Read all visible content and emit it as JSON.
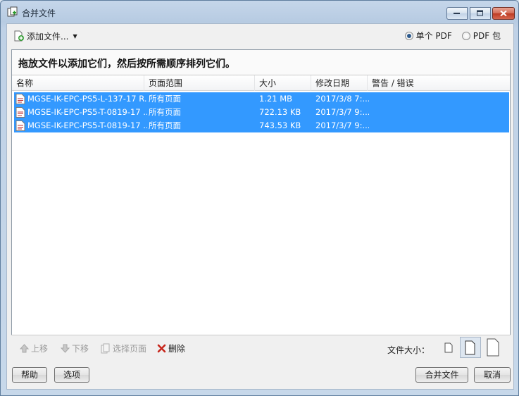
{
  "window": {
    "title": "合并文件",
    "controls": {
      "minimize": "minimize-icon",
      "maximize": "maximize-icon",
      "close": "close-icon"
    }
  },
  "toolbar_top": {
    "add_file_label": "添加文件...",
    "output_options": [
      {
        "label": "单个 PDF",
        "selected": true
      },
      {
        "label": "PDF 包",
        "selected": false
      }
    ]
  },
  "instruction": "拖放文件以添加它们，然后按所需顺序排列它们。",
  "table": {
    "columns": [
      "名称",
      "页面范围",
      "大小",
      "修改日期",
      "警告 / 错误"
    ],
    "rows": [
      {
        "name": "MGSE-IK-EPC-PS5-L-137-17 R...",
        "range": "所有页面",
        "size": "1.21 MB",
        "date": "2017/3/8 7:...",
        "warning": ""
      },
      {
        "name": "MGSE-IK-EPC-PS5-T-0819-17 ...",
        "range": "所有页面",
        "size": "722.13 KB",
        "date": "2017/3/7 9:...",
        "warning": ""
      },
      {
        "name": "MGSE-IK-EPC-PS5-T-0819-17 ...",
        "range": "所有页面",
        "size": "743.53 KB",
        "date": "2017/3/7 9:...",
        "warning": ""
      }
    ]
  },
  "bottom_toolbar": {
    "move_up": "上移",
    "move_down": "下移",
    "choose_pages": "选择页面",
    "delete": "删除",
    "file_size_label": "文件大小："
  },
  "footer": {
    "help": "帮助",
    "options": "选项",
    "combine": "合并文件",
    "cancel": "取消"
  },
  "colors": {
    "selection": "#3399ff",
    "accent": "#2d5a8d"
  }
}
